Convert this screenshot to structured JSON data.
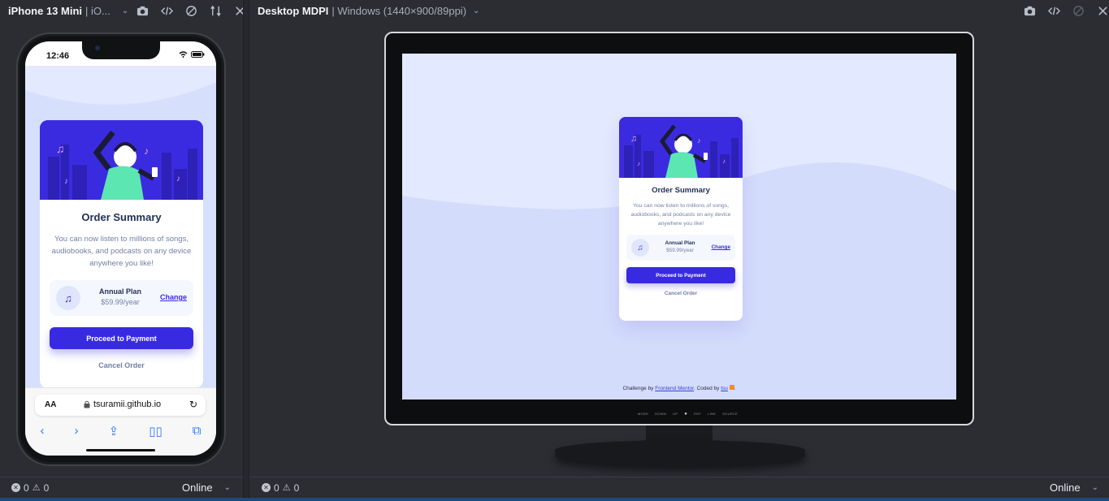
{
  "mobile_panel": {
    "device_name": "iPhone 13 Mini",
    "device_sub": "| iO...",
    "status_time": "12:46",
    "url_aa": "AA",
    "url": "tsuramii.github.io",
    "footer": {
      "errors": "0",
      "warnings": "0",
      "network": "Online"
    }
  },
  "desktop_panel": {
    "device_name": "Desktop MDPI",
    "device_sub": "| Windows (1440×900/89ppi)",
    "footer": {
      "errors": "0",
      "warnings": "0",
      "network": "Online"
    },
    "monitor_buttons": [
      "MODE",
      "DOWN",
      "UP",
      "●",
      "ENT",
      "LINE",
      "SOURCE"
    ]
  },
  "order_card": {
    "title": "Order Summary",
    "description": "You can now listen to millions of songs, audiobooks, and podcasts on any device anywhere you like!",
    "plan_name": "Annual Plan",
    "plan_price": "$59.99/year",
    "change_label": "Change",
    "proceed_label": "Proceed to Payment",
    "cancel_label": "Cancel Order"
  },
  "attribution": {
    "prefix": "Challenge by",
    "frontend_mentor": "Frontend Mentor",
    "middle": ". Coded by",
    "author": "tsu",
    "suffix": "."
  },
  "colors": {
    "brand": "#382ae1",
    "background": "#d6e0fd",
    "heading": "#1f2f56",
    "muted": "#717fa6"
  }
}
